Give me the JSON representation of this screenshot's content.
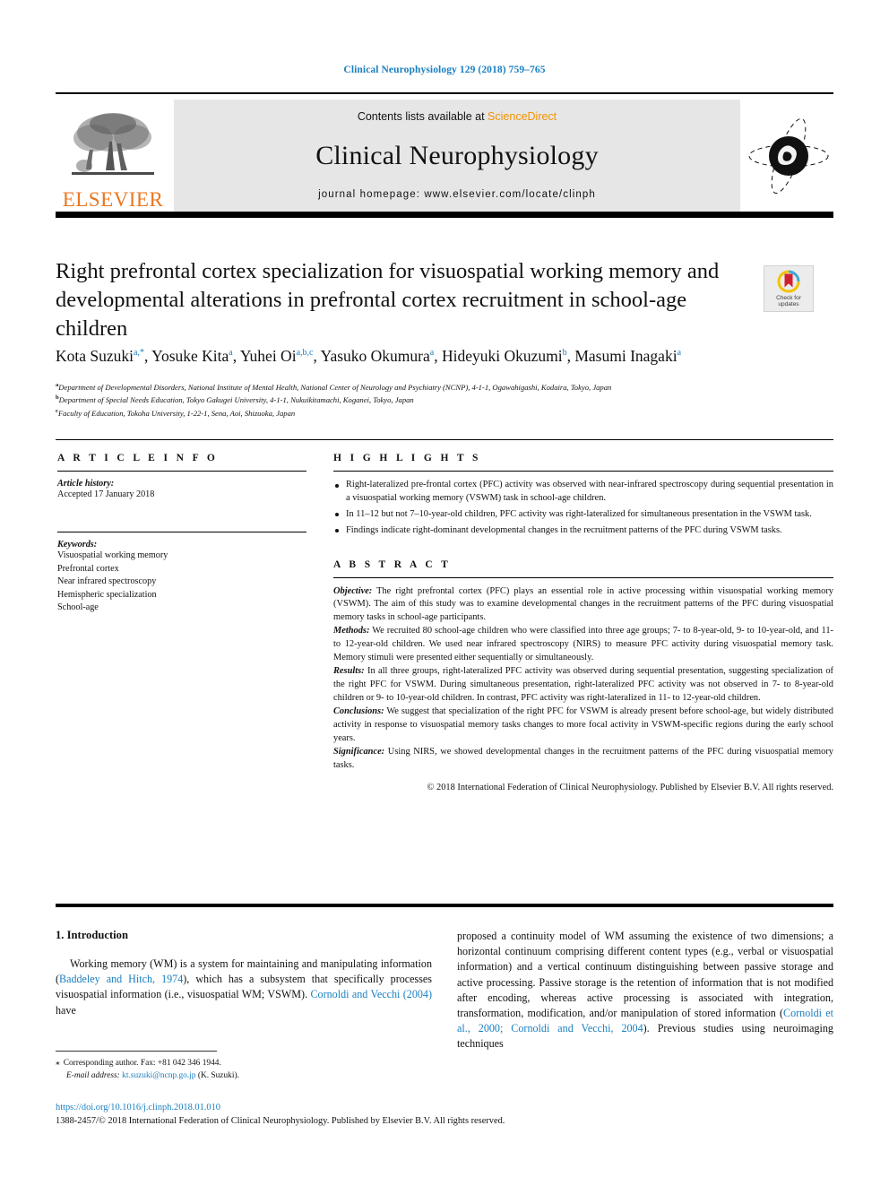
{
  "running_head": "Clinical Neurophysiology 129 (2018) 759–765",
  "masthead": {
    "publisher_name": "ELSEVIER",
    "contents_prefix": "Contents lists available at ",
    "contents_link": "ScienceDirect",
    "journal_name": "Clinical Neurophysiology",
    "homepage": "journal homepage: www.elsevier.com/locate/clinph"
  },
  "crossmark": {
    "line1": "Check for",
    "line2": "updates"
  },
  "article": {
    "title": "Right prefrontal cortex specialization for visuospatial working memory and developmental alterations in prefrontal cortex recruitment in school-age children"
  },
  "authors": [
    {
      "name": "Kota Suzuki",
      "sup": "a,*"
    },
    {
      "name": "Yosuke Kita",
      "sup": "a"
    },
    {
      "name": "Yuhei Oi",
      "sup": "a,b,c"
    },
    {
      "name": "Yasuko Okumura",
      "sup": "a"
    },
    {
      "name": "Hideyuki Okuzumi",
      "sup": "b"
    },
    {
      "name": "Masumi Inagaki",
      "sup": "a"
    }
  ],
  "affiliations": [
    {
      "mark": "a",
      "text": "Department of Developmental Disorders, National Institute of Mental Health, National Center of Neurology and Psychiatry (NCNP), 4-1-1, Ogawahigashi, Kodaira, Tokyo, Japan"
    },
    {
      "mark": "b",
      "text": "Department of Special Needs Education, Tokyo Gakugei University, 4-1-1, Nukuikitamachi, Koganei, Tokyo, Japan"
    },
    {
      "mark": "c",
      "text": "Faculty of Education, Tokoha University, 1-22-1, Sena, Aoi, Shizuoka, Japan"
    }
  ],
  "article_info": {
    "heading": "A R T I C L E   I N F O",
    "history_label": "Article history:",
    "history_value": "Accepted 17 January 2018",
    "keywords_label": "Keywords:",
    "keywords": [
      "Visuospatial working memory",
      "Prefrontal cortex",
      "Near infrared spectroscopy",
      "Hemispheric specialization",
      "School-age"
    ]
  },
  "highlights": {
    "heading": "H I G H L I G H T S",
    "items": [
      "Right-lateralized pre-frontal cortex (PFC) activity was observed with near-infrared spectroscopy during sequential presentation in a visuospatial working memory (VSWM) task in school-age children.",
      "In 11–12 but not 7–10-year-old children, PFC activity was right-lateralized for simultaneous presentation in the VSWM task.",
      "Findings indicate right-dominant developmental changes in the recruitment patterns of the PFC during VSWM tasks."
    ]
  },
  "abstract": {
    "heading": "A B S T R A C T",
    "sections": [
      {
        "label": "Objective:",
        "text": " The right prefrontal cortex (PFC) plays an essential role in active processing within visuospatial working memory (VSWM). The aim of this study was to examine developmental changes in the recruitment patterns of the PFC during visuospatial memory tasks in school-age participants."
      },
      {
        "label": "Methods:",
        "text": " We recruited 80 school-age children who were classified into three age groups; 7- to 8-year-old, 9- to 10-year-old, and 11- to 12-year-old children. We used near infrared spectroscopy (NIRS) to measure PFC activity during visuospatial memory task. Memory stimuli were presented either sequentially or simultaneously."
      },
      {
        "label": "Results:",
        "text": " In all three groups, right-lateralized PFC activity was observed during sequential presentation, suggesting specialization of the right PFC for VSWM. During simultaneous presentation, right-lateralized PFC activity was not observed in 7- to 8-year-old children or 9- to 10-year-old children. In contrast, PFC activity was right-lateralized in 11- to 12-year-old children."
      },
      {
        "label": "Conclusions:",
        "text": " We suggest that specialization of the right PFC for VSWM is already present before school-age, but widely distributed activity in response to visuospatial memory tasks changes to more focal activity in VSWM-specific regions during the early school years."
      },
      {
        "label": "Significance:",
        "text": " Using NIRS, we showed developmental changes in the recruitment patterns of the PFC during visuospatial memory tasks."
      }
    ],
    "copyright": "© 2018 International Federation of Clinical Neurophysiology. Published by Elsevier B.V. All rights reserved."
  },
  "body": {
    "section_heading": "1. Introduction",
    "left_column": {
      "part1": "Working memory (WM) is a system for maintaining and manipulating information (",
      "ref1": "Baddeley and Hitch, 1974",
      "part2": "), which has a subsystem that specifically processes visuospatial information (i.e., visuospatial WM; VSWM). ",
      "ref2": "Cornoldi and Vecchi (2004)",
      "part3": " have"
    },
    "right_column": {
      "part1": "proposed a continuity model of WM assuming the existence of two dimensions; a horizontal continuum comprising different content types (e.g., verbal or visuospatial information) and a vertical continuum distinguishing between passive storage and active processing. Passive storage is the retention of information that is not modified after encoding, whereas active processing is associated with integration, transformation, modification, and/or manipulation of stored information (",
      "ref1": "Cornoldi et al., 2000; Cornoldi and Vecchi, 2004",
      "part2": "). Previous studies using neuroimaging techniques"
    }
  },
  "footnote": {
    "star": "⁎",
    "corresponding": "Corresponding author. Fax: +81 042 346 1944.",
    "email_label": "E-mail address:",
    "email": "kt.suzuki@ncnp.go.jp",
    "email_suffix": "(K. Suzuki)."
  },
  "footer": {
    "doi": "https://doi.org/10.1016/j.clinph.2018.01.010",
    "issn_line": "1388-2457/© 2018 International Federation of Clinical Neurophysiology. Published by Elsevier B.V. All rights reserved."
  },
  "colors": {
    "link_blue": "#1a7fc1",
    "elsevier_orange": "#e87722",
    "sciencedirect_orange": "#f29400",
    "band_grey": "#e6e6e6"
  }
}
